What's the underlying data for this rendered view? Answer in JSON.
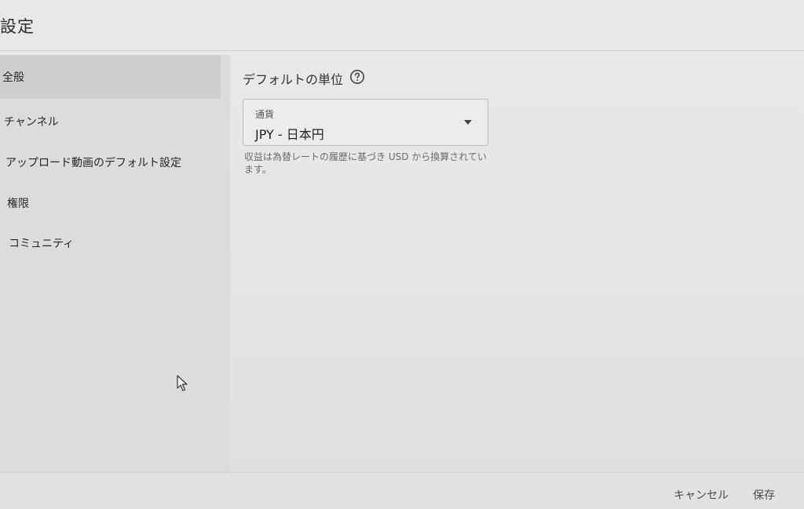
{
  "header": {
    "title": "設定"
  },
  "sidebar": {
    "items": [
      {
        "label": "全般"
      },
      {
        "label": "チャンネル"
      },
      {
        "label": "アップロード動画のデフォルト設定"
      },
      {
        "label": "権限"
      },
      {
        "label": "コミュニティ"
      }
    ],
    "selected_index": 0
  },
  "main": {
    "section_title": "デフォルトの単位",
    "help_icon": "help-circle-icon",
    "currency_select": {
      "label": "通貨",
      "value": "JPY - 日本円",
      "icon": "dropdown-arrow-icon"
    },
    "helper_text": "収益は為替レートの履歴に基づき USD から換算されています。"
  },
  "footer": {
    "cancel_label": "キャンセル",
    "save_label": "保存"
  },
  "colors": {
    "background": "#e5e5e5",
    "sidebar_bg": "#dcdcdc",
    "selected_bg": "#cfcfcf",
    "button_text": "#4a4a4a"
  }
}
